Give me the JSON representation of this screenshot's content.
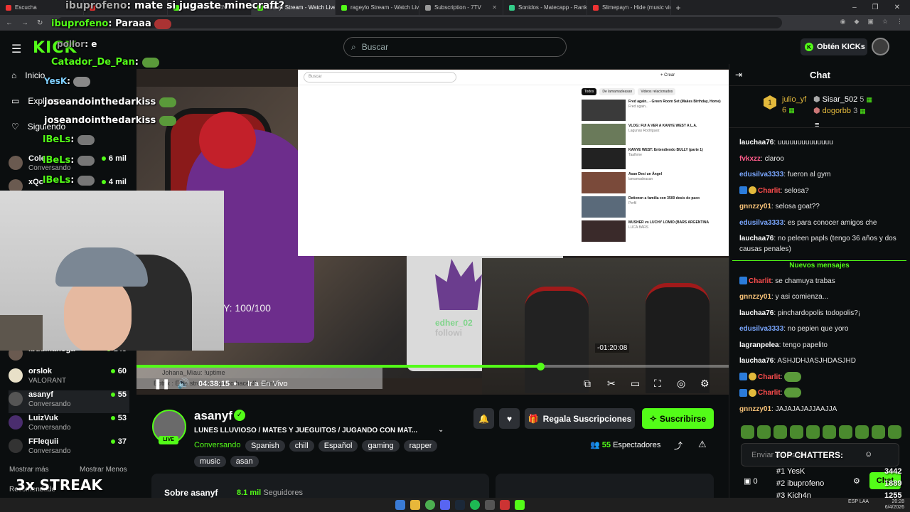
{
  "browser": {
    "tabs": [
      {
        "label": "Escucha",
        "color": "#e33"
      },
      {
        "label": "",
        "color": "#e33"
      },
      {
        "label": "DO CHANGA EN",
        "color": "#53fc18"
      },
      {
        "label": "asanyf Stream - Watch Live",
        "color": "#53fc18",
        "active": true
      },
      {
        "label": "rageylo Stream - Watch Live o",
        "color": "#53fc18"
      },
      {
        "label": "Subscription - 7TV",
        "color": "#999"
      },
      {
        "label": "Sonidos - Matecapp - Ranking",
        "color": "#3c8"
      },
      {
        "label": "Slimepayn - Hide (music video)",
        "color": "#e33"
      }
    ],
    "newtab": "+",
    "window_controls": [
      "–",
      "❐",
      "✕"
    ]
  },
  "header": {
    "logo": "KICK",
    "search_placeholder": "Buscar",
    "get_kicks": "Obtén KICKs"
  },
  "sidebar": {
    "nav": [
      {
        "label": "Inicio",
        "icon": "home-icon",
        "glyph": "⌂"
      },
      {
        "label": "Explorar",
        "icon": "browse-icon",
        "glyph": "▭"
      },
      {
        "label": "Siguiendo",
        "icon": "heart-icon",
        "glyph": "♡"
      }
    ],
    "channels_top": [
      {
        "name": "Cole",
        "category": "Conversando",
        "viewers": "6 mil"
      },
      {
        "name": "xQc",
        "category": "",
        "viewers": "4 mil"
      }
    ],
    "channels": [
      {
        "name": "ibudinanoga",
        "category": "",
        "viewers": "145"
      },
      {
        "name": "orslok",
        "category": "VALORANT",
        "viewers": "60"
      },
      {
        "name": "asanyf",
        "category": "Conversando",
        "viewers": "55",
        "selected": true
      },
      {
        "name": "LuizVuk",
        "category": "Conversando",
        "viewers": "53"
      },
      {
        "name": "FFlequii",
        "category": "Conversando",
        "viewers": "37"
      }
    ],
    "show_more": "Mostrar más",
    "show_less": "Mostrar Menos",
    "recommended": "Recomendado"
  },
  "overlay_chat": [
    {
      "user": "ibuprofeno",
      "text": "mate si jugaste minecraft?",
      "color": "#53fc18"
    },
    {
      "user": "ibuprofeno",
      "text": "Paraaa",
      "color": "#53fc18"
    },
    {
      "user": "pollor",
      "text": "e",
      "color": "#53fc18"
    },
    {
      "user": "Catador_De_Pan",
      "text": "",
      "color": "#53fc18"
    },
    {
      "user": "YesK",
      "text": "",
      "color": "#7fd0ff"
    },
    {
      "user": "joseandointhedarkiss",
      "text": "",
      "color": "#ffffff"
    },
    {
      "user": "joseandointhedarkiss",
      "text": "",
      "color": "#ffffff"
    },
    {
      "user": "lBeLs",
      "text": "",
      "color": "#53fc18"
    },
    {
      "user": "lBeLs",
      "text": "",
      "color": "#53fc18"
    },
    {
      "user": "lBeLs",
      "text": "",
      "color": "#53fc18"
    }
  ],
  "stream_overlay": {
    "hp": "Y: 100/100",
    "scan_user": "edher_02",
    "scan_sub": "followi",
    "uptime_user": "Johana_Miau",
    "uptime_cmd": "!uptime",
    "uptime_reply": "Botrix : Este stream empezo hace 4h 38min.",
    "streak": "3x STREAK"
  },
  "player": {
    "time": "04:38:15",
    "go_live": "Ir a En Vivo",
    "seek_time": "-01:20:08",
    "progress": 0.682
  },
  "inset_youtube": {
    "search_placeholder": "Buscar",
    "create": "+ Crear",
    "chips": [
      "Todos",
      "De lamamadeasan",
      "Videos relacionados"
    ],
    "videos": [
      {
        "title": "Fred again.. - Green Room Set (Makes Birthday, Home)",
        "meta": "Fred again.."
      },
      {
        "title": "VLOG: FUI A VER A KANYE WEST A L.A.",
        "meta": "Lagunas Rodríguez"
      },
      {
        "title": "KANYE WEST: Entendiendo BULLY (parte 1)",
        "meta": "Taalhme"
      },
      {
        "title": "Asan Desi un Ángel",
        "meta": "lamamadeasan"
      },
      {
        "title": "Detienen a familia con 3500 dosis de paco",
        "meta": "Perfil"
      },
      {
        "title": "MUSHER vs LUCHY LOMIO (BARS ARGENTINA",
        "meta": "LUCA BARS"
      }
    ]
  },
  "stream": {
    "name": "asanyf",
    "live": "LIVE",
    "title": "LUNES LLUVIOSO / MATES Y JUEGUITOS / JUGANDO CON MAT...",
    "category": "Conversando",
    "tags": [
      "Spanish",
      "chill",
      "Español",
      "gaming",
      "rapper",
      "music",
      "asan"
    ],
    "gift_subs": "Regala Suscripciones",
    "subscribe": "Suscribirse",
    "viewers": "55",
    "viewers_label": "Espectadores",
    "about": "Sobre asanyf",
    "followers": "8.1 mil",
    "followers_label": "Seguidores"
  },
  "chat": {
    "title": "Chat",
    "top_gifters": [
      {
        "name": "julio_yf",
        "count": "6",
        "rank": "1"
      },
      {
        "name": "Sisar_502",
        "count": "5"
      },
      {
        "name": "dogorbb",
        "count": "3"
      }
    ],
    "messages": [
      {
        "user": "lauchaa76",
        "color": "#ffffff",
        "text": "uuuuuuuuuuuuuu"
      },
      {
        "user": "fvkxzz",
        "color": "#ff5c8a",
        "text": "claroo"
      },
      {
        "user": "edusilva3333",
        "color": "#7aa7ff",
        "text": "fueron al gym"
      },
      {
        "user": "Charlit",
        "color": "#ff4d4d",
        "text": "selosa?",
        "badges": true
      },
      {
        "user": "gnnzzy01",
        "color": "#f6c177",
        "text": "selosa goat??"
      },
      {
        "user": "edusilva3333",
        "color": "#7aa7ff",
        "text": "es para conocer amigos che"
      },
      {
        "user": "lauchaa76",
        "color": "#ffffff",
        "text": "no peleen papls (tengo 36 años y dos causas penales)"
      },
      {
        "divider": "Nuevos mensajes"
      },
      {
        "user": "Charlit",
        "color": "#ff4d4d",
        "text": "se chamuya trabas",
        "badges": true
      },
      {
        "user": "gnnzzy01",
        "color": "#f6c177",
        "text": "y asi comienza..."
      },
      {
        "user": "lauchaa76",
        "color": "#ffffff",
        "text": "pinchardopolis todopolis?¡"
      },
      {
        "user": "edusilva3333",
        "color": "#7aa7ff",
        "text": "no pepien que yoro"
      },
      {
        "user": "lagranpelea",
        "color": "#ffffff",
        "text": "tengo papelito"
      },
      {
        "user": "lauchaa76",
        "color": "#ffffff",
        "text": "ASHJDHJASJHDASJHD"
      },
      {
        "user": "Charlit",
        "color": "#ff4d4d",
        "text": "",
        "badges": true,
        "emote": true
      },
      {
        "user": "Charlit",
        "color": "#ff4d4d",
        "text": "",
        "badges": true,
        "emote": true
      },
      {
        "user": "gnnzzy01",
        "color": "#f6c177",
        "text": "JAJAJAJAJJAAJJA"
      }
    ],
    "input_placeholder": "Enviar mensaje",
    "send": "Chat",
    "kicks": "0",
    "top_chatters_title": "TOP CHATTERS:",
    "top_chatters": [
      {
        "rank": "#1 YesK",
        "count": "3442"
      },
      {
        "rank": "#2 ibuprofeno",
        "count": "1889"
      },
      {
        "rank": "#3 Kich4n",
        "count": "1255"
      }
    ]
  },
  "taskbar": {
    "lang": "ESP LAA",
    "time": "20:28",
    "date": "6/4/2026"
  },
  "colors": {
    "accent": "#53fc18",
    "bg": "#0b0e0f"
  }
}
